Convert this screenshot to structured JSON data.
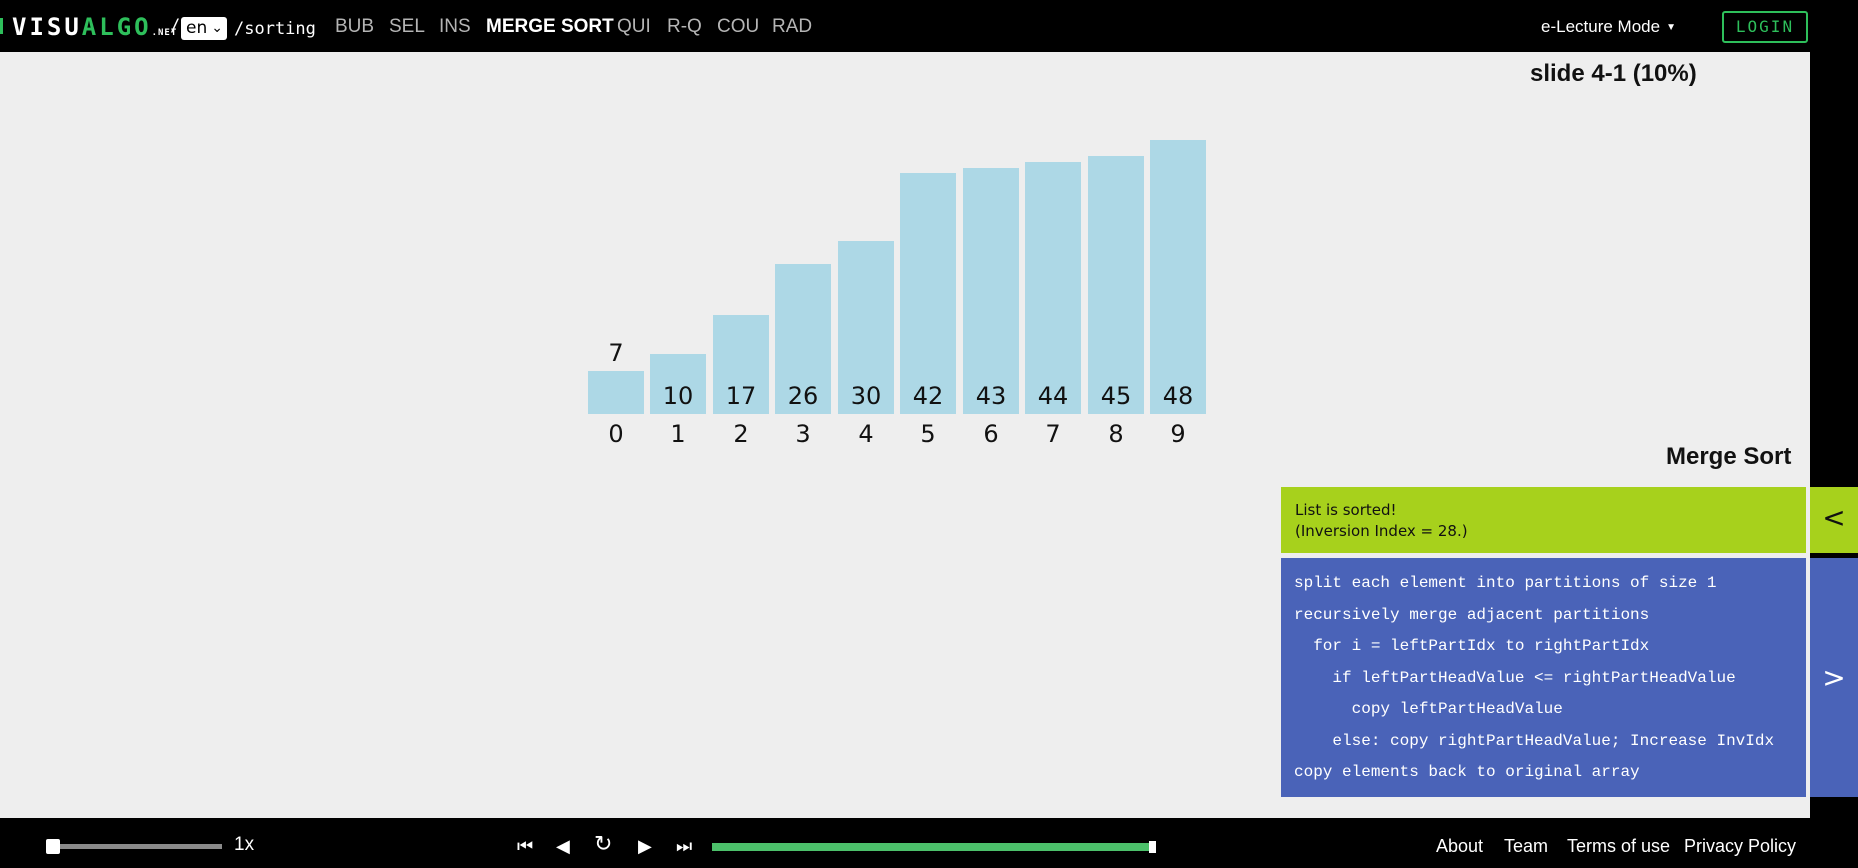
{
  "header": {
    "logo_visu": "VISU",
    "logo_algo": "ALGO",
    "logo_net": ".NET",
    "slash": "/",
    "language": "en",
    "path": "/sorting",
    "nav": [
      {
        "label": "BUB",
        "active": false
      },
      {
        "label": "SEL",
        "active": false
      },
      {
        "label": "INS",
        "active": false
      },
      {
        "label": "MERGE SORT",
        "active": true
      },
      {
        "label": "QUI",
        "active": false
      },
      {
        "label": "R-Q",
        "active": false
      },
      {
        "label": "COU",
        "active": false
      },
      {
        "label": "RAD",
        "active": false
      }
    ],
    "mode": "e-Lecture Mode",
    "login": "LOGIN"
  },
  "slide_label": "slide 4-1 (10%)",
  "bars": [
    {
      "index": "0",
      "value": "7"
    },
    {
      "index": "1",
      "value": "10"
    },
    {
      "index": "2",
      "value": "17"
    },
    {
      "index": "3",
      "value": "26"
    },
    {
      "index": "4",
      "value": "30"
    },
    {
      "index": "5",
      "value": "42"
    },
    {
      "index": "6",
      "value": "43"
    },
    {
      "index": "7",
      "value": "44"
    },
    {
      "index": "8",
      "value": "45"
    },
    {
      "index": "9",
      "value": "48"
    }
  ],
  "panel": {
    "title": "Merge Sort",
    "status_line1": "List is sorted!",
    "status_line2": "(Inversion Index = 28.)",
    "code": [
      "split each element into partitions of size 1",
      "recursively merge adjacent partitions",
      "  for i = leftPartIdx to rightPartIdx",
      "    if leftPartHeadValue <= rightPartHeadValue",
      "      copy leftPartHeadValue",
      "    else: copy rightPartHeadValue; Increase InvIdx",
      "copy elements back to original array"
    ]
  },
  "footer": {
    "speed": "1x",
    "speed_fraction": 0.0,
    "progress_fraction": 1.0,
    "links": [
      "About",
      "Team",
      "Terms of use",
      "Privacy Policy"
    ]
  },
  "colors": {
    "bar": "#add8e6",
    "status": "#a7d11c",
    "code": "#4a63b8",
    "accent": "#2ebf5b"
  }
}
